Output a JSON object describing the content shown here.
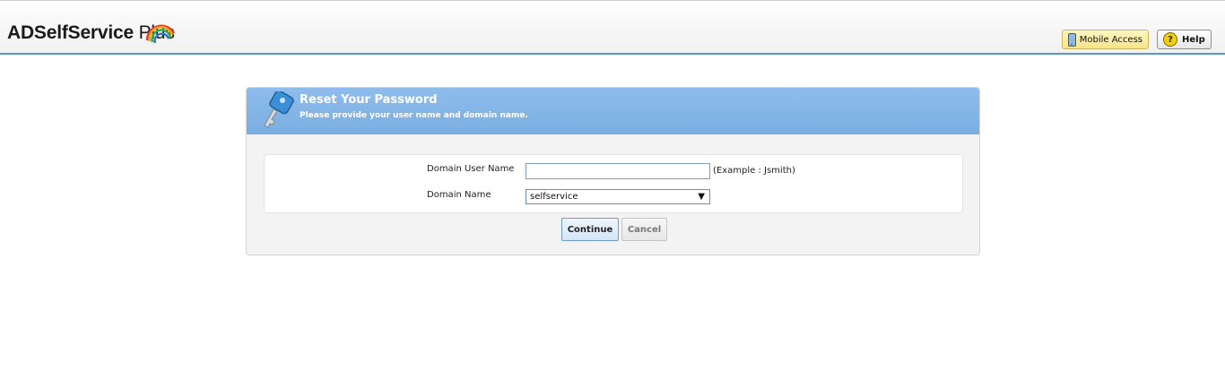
{
  "header": {
    "logo_main": "ADSelfService",
    "logo_suffix": "Plus",
    "mobile_access_label": "Mobile Access",
    "help_label": "Help",
    "help_icon_glyph": "?"
  },
  "panel": {
    "title": "Reset Your Password",
    "subtitle": "Please provide your user name and domain name."
  },
  "form": {
    "user_label": "Domain User Name",
    "user_value": "",
    "user_example": "(Example : Jsmith)",
    "domain_label": "Domain Name",
    "domain_selected": "selfservice",
    "domain_arrow": "▼"
  },
  "actions": {
    "continue_label": "Continue",
    "cancel_label": "Cancel"
  },
  "colors": {
    "accent_blue": "#7aaee2",
    "header_rule": "#5b95d2",
    "mobile_button": "#f6e58a"
  }
}
